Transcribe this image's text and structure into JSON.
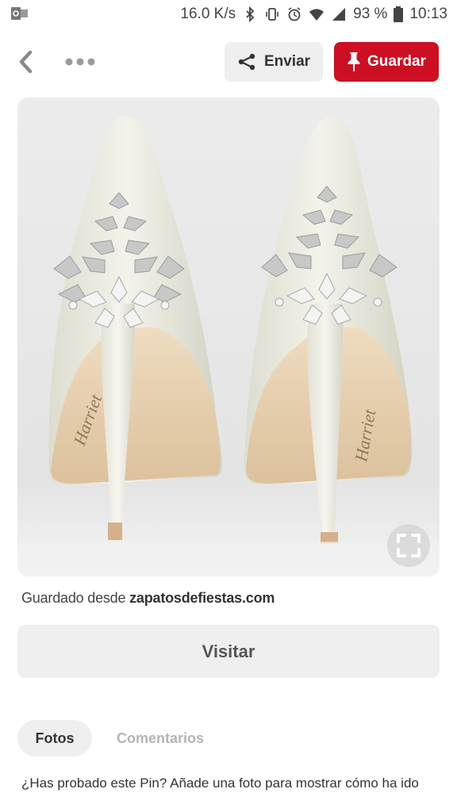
{
  "status_bar": {
    "speed": "16.0 K/s",
    "battery": "93 %",
    "time": "10:13"
  },
  "toolbar": {
    "send_label": "Enviar",
    "save_label": "Guardar",
    "save_color": "#cc0f22"
  },
  "image": {
    "kind": "photo",
    "subject": "white satin bridal heels with crystal leaf heel embellishment"
  },
  "saved_from": {
    "prefix": "Guardado desde ",
    "domain": "zapatosdefiestas.com"
  },
  "visit_label": "Visitar",
  "tabs": [
    {
      "label": "Fotos",
      "active": true
    },
    {
      "label": "Comentarios",
      "active": false
    }
  ],
  "prompt": "¿Has probado este Pin? Añade una foto para mostrar cómo ha ido"
}
